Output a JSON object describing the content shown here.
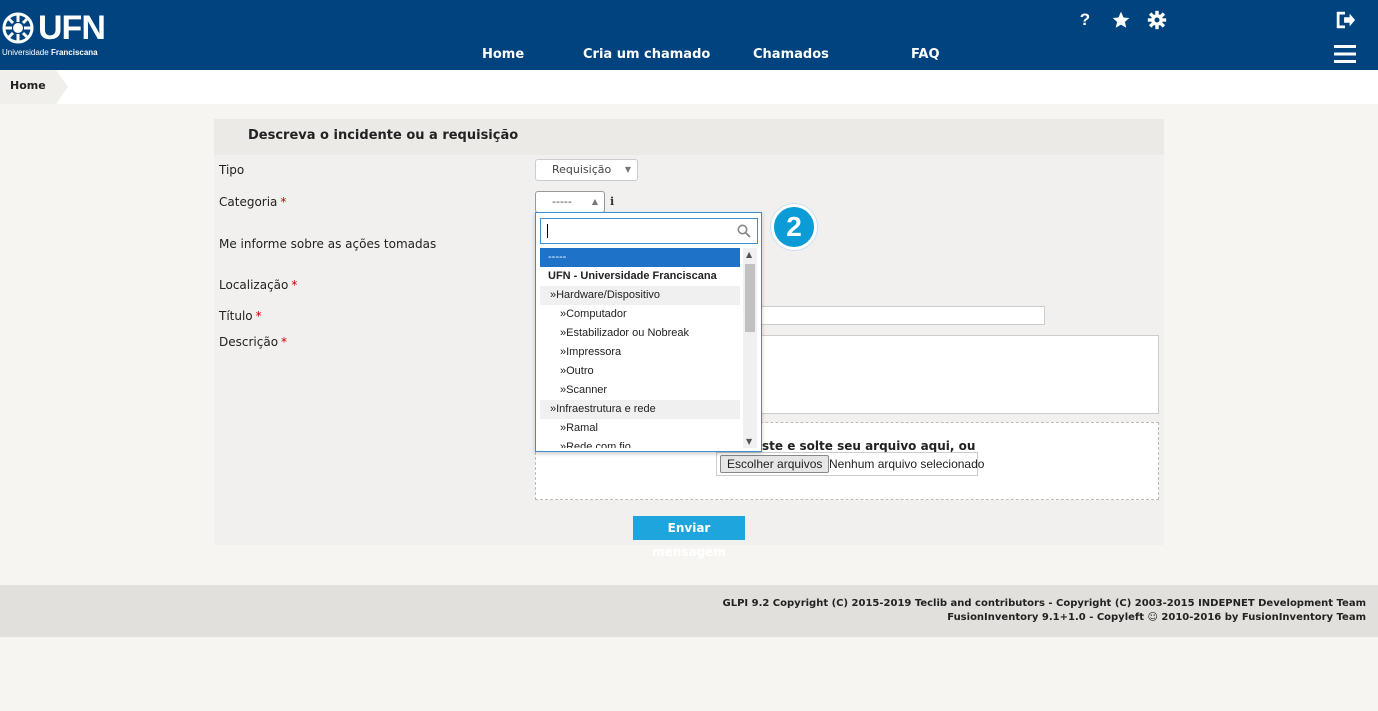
{
  "header": {
    "logo_text": "UFN",
    "logo_sub_light": "Universidade",
    "logo_sub_bold": "Franciscana",
    "help_icon": "question-icon",
    "nav": [
      {
        "label": "Home"
      },
      {
        "label": "Cria um chamado"
      },
      {
        "label": "Chamados"
      },
      {
        "label": "FAQ"
      }
    ]
  },
  "breadcrumb": {
    "home": "Home"
  },
  "form": {
    "title": "Descreva o incidente ou a requisição",
    "tipo_label": "Tipo",
    "tipo_value": "Requisição",
    "categoria_label": "Categoria",
    "categoria_value": "-----",
    "acoes_label": "Me informe sobre as ações tomadas",
    "localizacao_label": "Localização",
    "titulo_label": "Título",
    "descricao_label": "Descrição",
    "required_mark": "*",
    "dropzone_text": "ste e solte seu arquivo aqui, ou",
    "file_button": "Escolher arquivos",
    "file_status": "Nenhum arquivo selecionado",
    "submit": "Enviar mensagem"
  },
  "dropdown": {
    "search_value": "",
    "items": [
      {
        "label": "-----",
        "kind": "selected"
      },
      {
        "label": "UFN - Universidade Franciscana",
        "kind": "group"
      },
      {
        "label": "»Hardware/Dispositivo",
        "kind": "sub"
      },
      {
        "label": "»Computador",
        "kind": "leaf"
      },
      {
        "label": "»Estabilizador ou Nobreak",
        "kind": "leaf"
      },
      {
        "label": "»Impressora",
        "kind": "leaf"
      },
      {
        "label": "»Outro",
        "kind": "leaf"
      },
      {
        "label": "»Scanner",
        "kind": "leaf"
      },
      {
        "label": "»Infraestrutura e rede",
        "kind": "sub"
      },
      {
        "label": "»Ramal",
        "kind": "leaf"
      },
      {
        "label": "»Rede com fio",
        "kind": "leaf"
      }
    ]
  },
  "step_badge": "2",
  "footer": {
    "line1": "GLPI 9.2 Copyright (C) 2015-2019 Teclib and contributors - Copyright (C) 2003-2015 INDEPNET Development Team",
    "line2": "FusionInventory 9.1+1.0 - Copyleft ☺ 2010-2016 by FusionInventory Team"
  }
}
